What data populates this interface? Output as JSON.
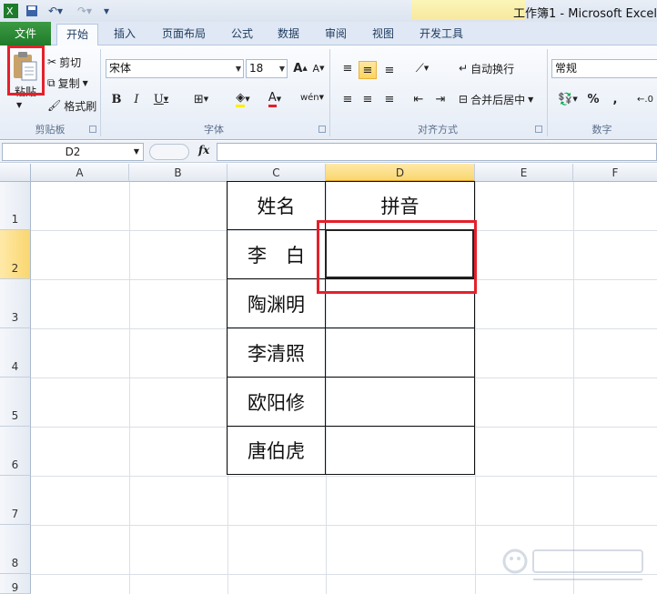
{
  "window": {
    "title": "工作簿1 - Microsoft Excel"
  },
  "tabs": [
    {
      "label": "文件"
    },
    {
      "label": "开始"
    },
    {
      "label": "插入"
    },
    {
      "label": "页面布局"
    },
    {
      "label": "公式"
    },
    {
      "label": "数据"
    },
    {
      "label": "审阅"
    },
    {
      "label": "视图"
    },
    {
      "label": "开发工具"
    }
  ],
  "ribbon": {
    "clipboard": {
      "group_label": "剪贴板",
      "paste": "粘贴",
      "cut": "剪切",
      "copy": "复制",
      "format_painter": "格式刷"
    },
    "font": {
      "group_label": "字体",
      "font_name": "宋体",
      "font_size": "18"
    },
    "alignment": {
      "group_label": "对齐方式",
      "wrap_text": "自动换行",
      "merge_center": "合并后居中"
    },
    "number": {
      "group_label": "数字",
      "format": "常规",
      "percent": "%",
      "comma": ","
    }
  },
  "formula_bar": {
    "name_box": "D2",
    "fx": "fx"
  },
  "columns": [
    "A",
    "B",
    "C",
    "D",
    "E",
    "F"
  ],
  "rows": [
    "1",
    "2",
    "3",
    "4",
    "5",
    "6",
    "7",
    "8",
    "9"
  ],
  "table": {
    "header_name": "姓名",
    "header_pinyin": "拼音",
    "names": [
      "李　白",
      "陶渊明",
      "李清照",
      "欧阳修",
      "唐伯虎"
    ]
  },
  "colors": {
    "accent_select": "#f9d66f",
    "highlight_red": "#e5202b",
    "file_tab": "#1f7b2b"
  }
}
